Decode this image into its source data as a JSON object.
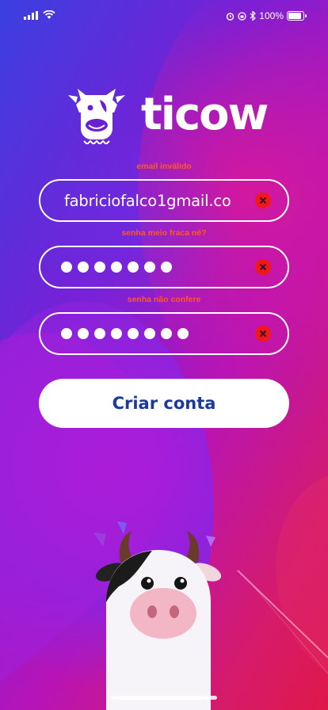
{
  "status_bar": {
    "battery_text": "100%",
    "battery_level": 1.0,
    "icons": [
      "signal-icon",
      "wifi-icon",
      "alarm-icon",
      "orientation-lock-icon",
      "bluetooth-icon",
      "battery-icon"
    ]
  },
  "logo": {
    "text": "ticow",
    "icon": "cow-logo-icon"
  },
  "form": {
    "email": {
      "error": "email inválido",
      "value": "fabriciofalco1gmail.co",
      "clear_icon": "clear-icon"
    },
    "password": {
      "error": "senha meio fraca né?",
      "masked_length": 7,
      "clear_icon": "clear-icon"
    },
    "confirm": {
      "error": "senha não confere",
      "masked_length": 8,
      "clear_icon": "clear-icon"
    },
    "submit_label": "Criar conta"
  },
  "mascot": {
    "icon": "cow-mascot-illustration"
  },
  "colors": {
    "error": "#ff5a1f",
    "clear_button": "#f01818",
    "button_text": "#1a3a9c"
  }
}
